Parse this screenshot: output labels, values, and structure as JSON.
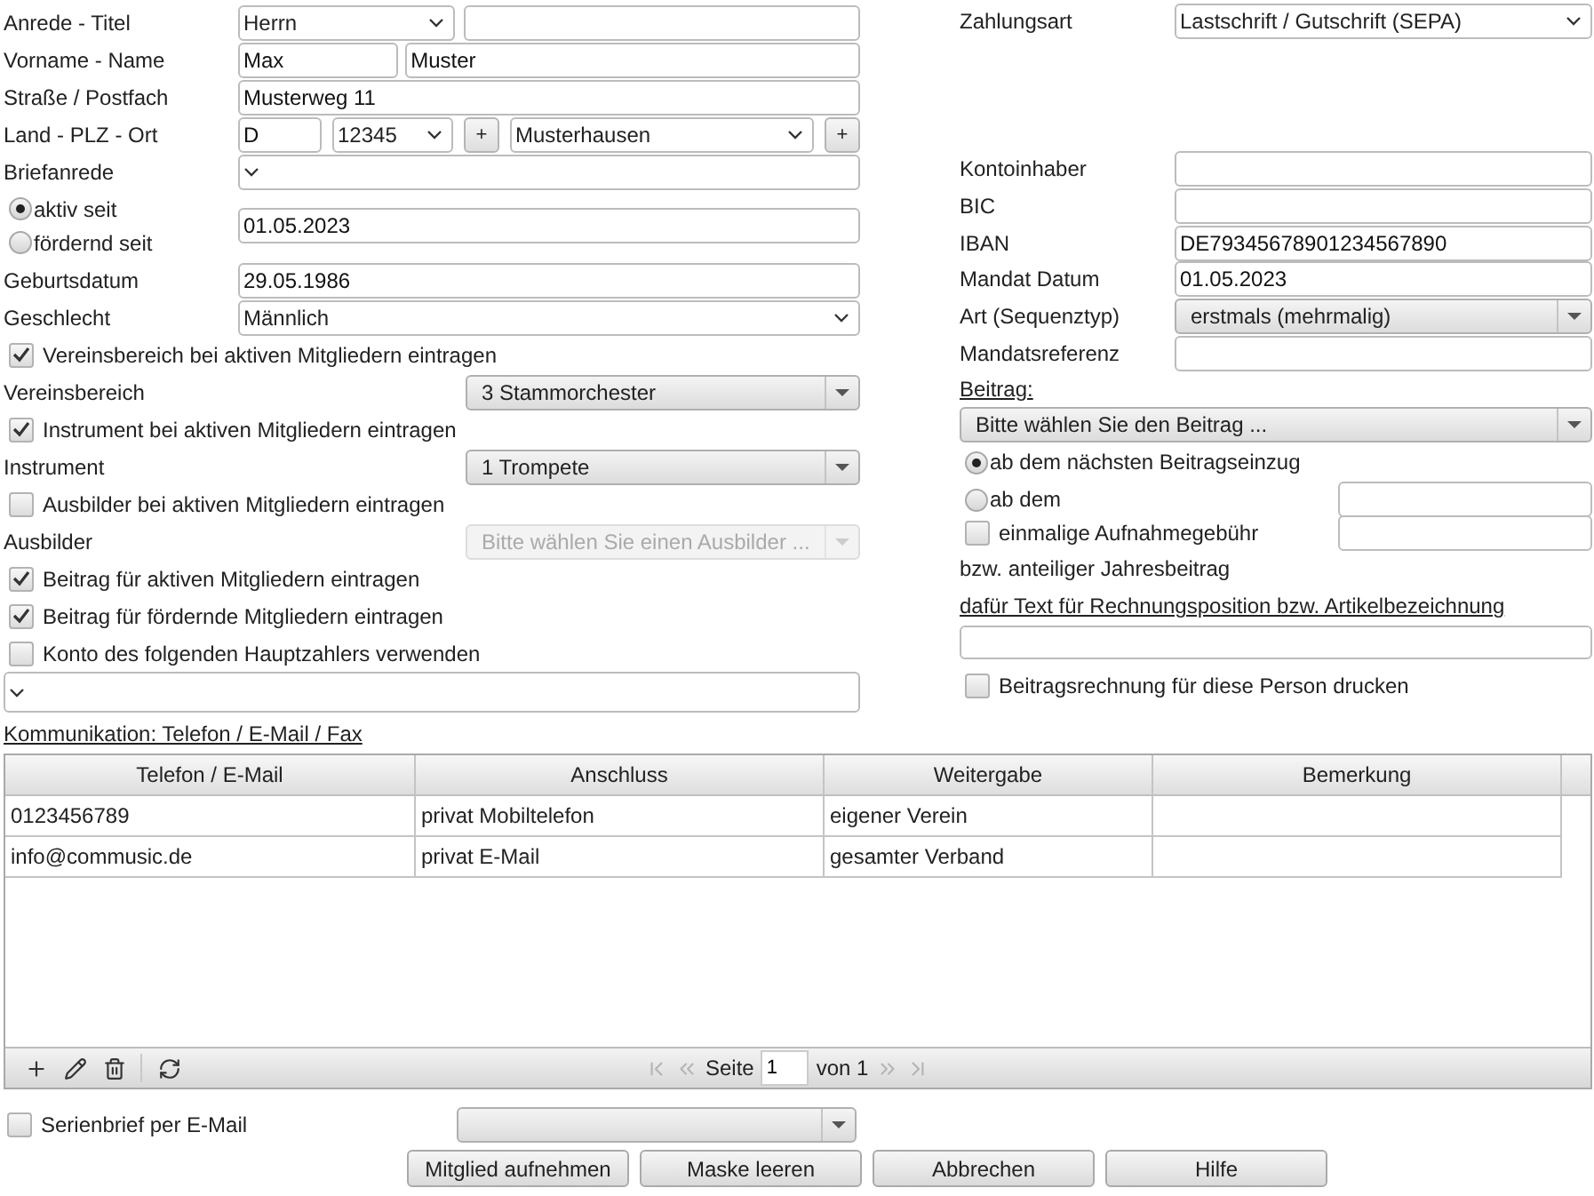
{
  "person": {
    "salutation": {
      "label": "Anrede - Titel",
      "value": "Herrn"
    },
    "name": {
      "label": "Vorname - Name",
      "first_name": "Max",
      "last_name": "Muster"
    },
    "street": {
      "label": "Straße / Postfach",
      "value": "Musterweg 11"
    },
    "place": {
      "label": "Land - PLZ - Ort",
      "country": "D",
      "postcode": "12345",
      "city": "Musterhausen",
      "add_labels": [
        "+",
        "+"
      ]
    },
    "letter_salutation": {
      "label": "Briefanrede"
    },
    "membership": {
      "options": [
        {
          "label": "aktiv seit",
          "selected": true
        },
        {
          "label": "fördernd seit",
          "selected": false
        }
      ],
      "date": "01.05.2023"
    },
    "birth_date": {
      "label": "Geburtsdatum",
      "value": "29.05.1986"
    },
    "gender": {
      "label": "Geschlecht",
      "value": "Männlich"
    },
    "assignments": [
      {
        "check_label": "Vereinsbereich bei aktiven Mitgliedern eintragen",
        "checked": true,
        "label": "Vereinsbereich",
        "value": "3 Stammorchester",
        "disabled": false
      },
      {
        "check_label": "Instrument bei aktiven Mitgliedern eintragen",
        "checked": true,
        "label": "Instrument",
        "value": "1 Trompete",
        "disabled": false
      },
      {
        "check_label": "Ausbilder bei aktiven Mitgliedern eintragen",
        "checked": false,
        "label": "Ausbilder",
        "placeholder": "Bitte wählen Sie einen Ausbilder ...",
        "disabled": true
      }
    ],
    "fee_checks": [
      {
        "label": "Beitrag für aktiven Mitgliedern eintragen",
        "checked": true
      },
      {
        "label": "Beitrag für fördernde Mitgliedern eintragen",
        "checked": true
      },
      {
        "label": "Konto des folgenden Hauptzahlers verwenden",
        "checked": false
      }
    ]
  },
  "payment": {
    "method": {
      "label": "Zahlungsart",
      "value": "Lastschrift / Gutschrift (SEPA)"
    },
    "bank_fields": [
      {
        "kind": "input",
        "label": "Kontoinhaber"
      },
      {
        "kind": "input",
        "label": "BIC"
      },
      {
        "kind": "input",
        "label": "IBAN",
        "value": "DE79345678901234567890"
      },
      {
        "kind": "input",
        "label": "Mandat Datum",
        "value": "01.05.2023"
      },
      {
        "kind": "combo",
        "label": "Art (Sequenztyp)",
        "value": "erstmals (mehrmalig)"
      },
      {
        "kind": "input",
        "label": "Mandatsreferenz"
      }
    ],
    "fee": {
      "title": "Beitrag:",
      "placeholder": "Bitte wählen Sie den Beitrag ...",
      "start_options": [
        {
          "label": "ab dem nächsten Beitragseinzug",
          "selected": true
        },
        {
          "label": "ab dem",
          "selected": false
        }
      ],
      "admission_fee": {
        "label": "einmalige Aufnahmegebühr",
        "checked": false
      },
      "note": "bzw. anteiliger Jahresbeitrag",
      "invoice_text_label": "dafür Text für Rechnungsposition bzw. Artikelbezeichnung",
      "print_invoice": {
        "label": "Beitragsrechnung für diese Person drucken",
        "checked": false
      }
    }
  },
  "communication": {
    "title": "Kommunikation: Telefon / E-Mail / Fax",
    "columns": [
      "Telefon / E-Mail",
      "Anschluss",
      "Weitergabe",
      "Bemerkung"
    ],
    "rows": [
      [
        "0123456789",
        "privat Mobiltelefon",
        "eigener Verein"
      ],
      [
        "info@commusic.de",
        "privat E-Mail",
        "gesamter Verband"
      ]
    ],
    "pager": {
      "page_label": "Seite",
      "page": "1",
      "of_label": "von 1"
    }
  },
  "footer": {
    "serial_letter": {
      "label": "Serienbrief per E-Mail",
      "checked": false
    },
    "buttons": [
      "Mitglied aufnehmen",
      "Maske leeren",
      "Abbrechen",
      "Hilfe"
    ]
  }
}
